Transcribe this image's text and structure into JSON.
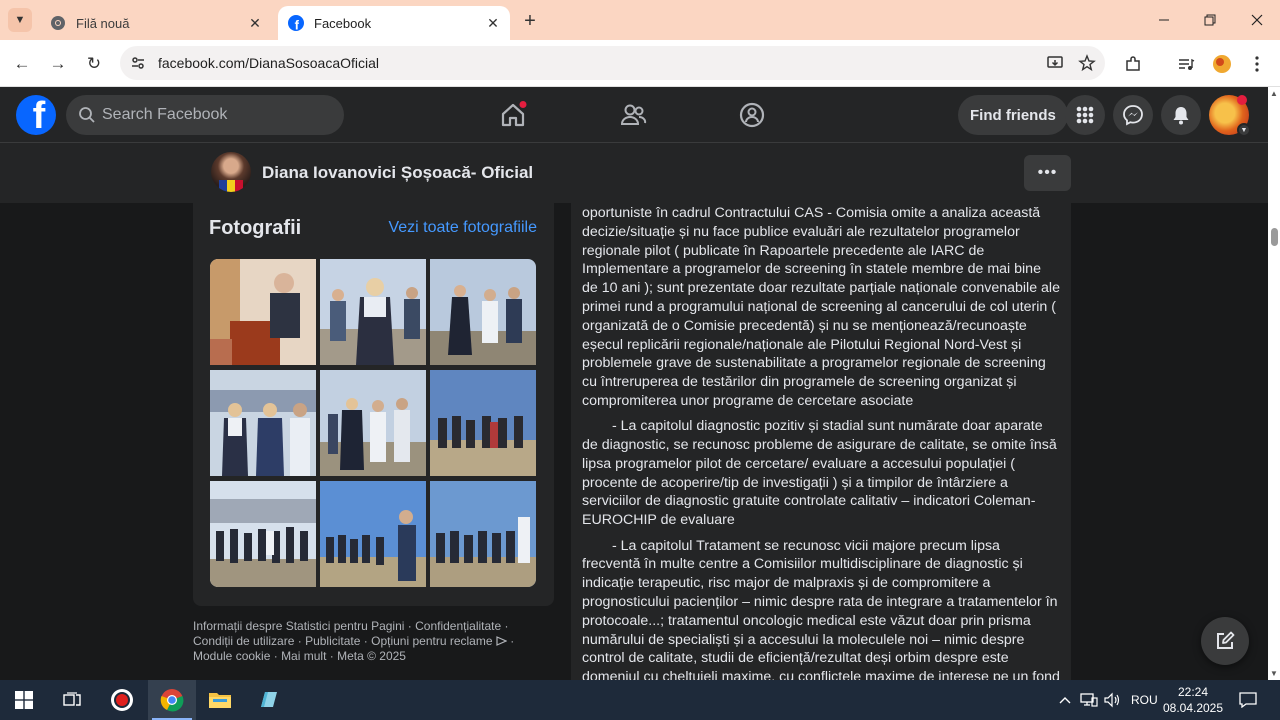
{
  "browser": {
    "tabs": [
      {
        "title": "Filă nouă",
        "favicon": "chrome-icon",
        "active": false
      },
      {
        "title": "Facebook",
        "favicon": "facebook-icon",
        "active": true
      }
    ],
    "url": "facebook.com/DianaSosoacaOficial"
  },
  "facebook": {
    "logo_letter": "f",
    "search_placeholder": "Search Facebook",
    "find_friends_label": "Find friends",
    "page_name": "Diana Iovanovici Șoșoacă- Oficial"
  },
  "photos": {
    "title": "Fotografii",
    "see_all": "Vezi toate fotografiile",
    "colors": [
      "#c7a27f",
      "#8aa0c0",
      "#7a95b8",
      "#8ca5c8",
      "#92a9c5",
      "#6f8db4",
      "#95a6b8",
      "#6b88b5",
      "#7d98be"
    ]
  },
  "footer": {
    "links": [
      "Informații despre Statistici pentru Pagini",
      "Confidențialitate",
      "Condiții de utilizare",
      "Publicitate",
      "Opțiuni pentru reclame",
      "Module cookie",
      "Mai mult",
      "Meta © 2025"
    ]
  },
  "post": {
    "p1": "oportuniste în cadrul Contractului CAS - Comisia omite a analiza această decizie/situație și nu face publice evaluări ale rezultatelor programelor regionale pilot ( publicate în Rapoartele precedente ale IARC de Implementare a programelor de screening în statele membre de mai bine de 10 ani ); sunt prezentate doar rezultate parțiale naționale convenabile ale primei rund a programului național de screening al cancerului de col uterin ( organizată de o Comisie precedentă) și nu se menționează/recunoaște eșecul replicării regionale/naționale ale Pilotului Regional Nord-Vest și problemele grave de sustenabilitate a programelor regionale de screening cu întreruperea de testărilor din programele de screening organizat  și compromiterea unor programe de cercetare asociate",
    "p2": "- La capitolul diagnostic pozitiv și stadial sunt numărate doar aparate de diagnostic,  se recunosc probleme de asigurare de calitate, se omite însă lipsa programelor pilot de cercetare/ evaluare  a accesului populației ( procente de acoperire/tip de investigații ) și a timpilor de întârziere a serviciilor de diagnostic gratuite controlate calitativ – indicatori Coleman-EUROCHIP  de evaluare",
    "p3": "- La capitolul Tratament se recunosc vicii majore precum lipsa frecventă în multe centre a Comisiilor multidisciplinare de diagnostic și indicație terapeutic, risc major de malpraxis și de compromitere a prognosticului pacienților – nimic despre rata de integrare a tratamentelor în protocoale...; tratamentul oncologic medical este văzut doar prin prisma numărului de specialiști și a accesului la moleculele noi – nimic despre control de calitate, studii de eficiență/rezultat deși  orbim despre este domeniul cu cheltuieli maxime, cu conflictele maxime de interese pe un fond legislativ labil al"
  },
  "taskbar": {
    "language": "ROU",
    "time": "22:24",
    "date": "08.04.2025"
  }
}
